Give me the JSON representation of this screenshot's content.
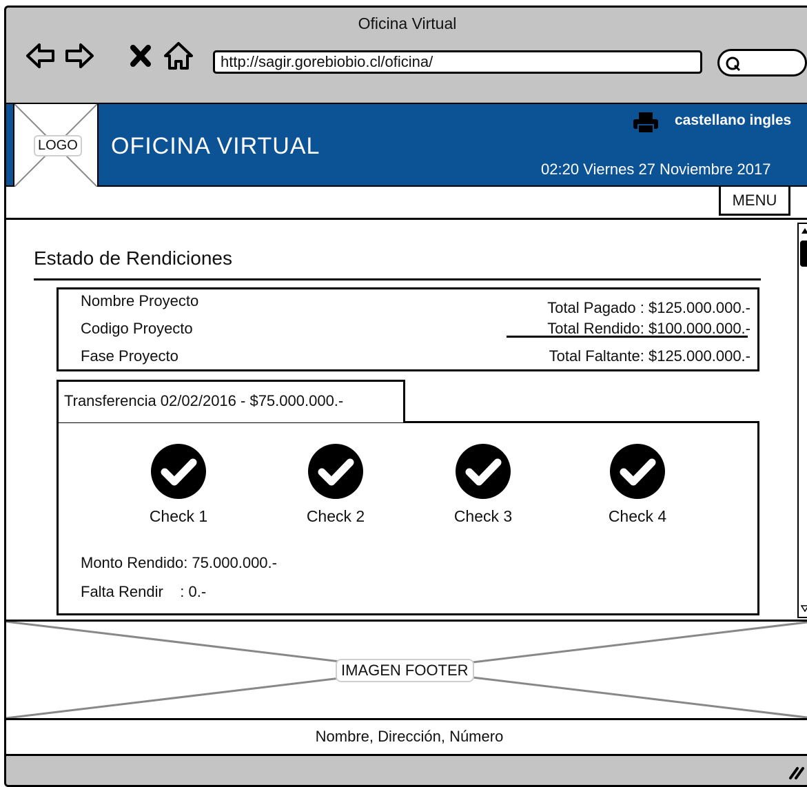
{
  "browser": {
    "title": "Oficina Virtual",
    "url": "http://sagir.gorebiobio.cl/oficina/",
    "nav_icons": [
      "back-arrow-icon",
      "forward-arrow-icon",
      "stop-icon",
      "home-icon"
    ],
    "search_icon": "search-icon"
  },
  "header": {
    "logo_label": "LOGO",
    "site_title": "OFICINA VIRTUAL",
    "print_icon": "printer-icon",
    "languages": "castellano ingles",
    "datetime": "02:20 Viernes 27 Noviembre 2017",
    "background_color": "#0c5396"
  },
  "menu": {
    "label": "MENU"
  },
  "main": {
    "page_title": "Estado de Rendiciones",
    "project": {
      "left": [
        "Nombre Proyecto",
        "Codigo Proyecto",
        "Fase Proyecto"
      ],
      "total_pagado": "Total Pagado : $125.000.000.-",
      "total_rendido": "Total Rendido: $100.000.000.-",
      "total_faltante": "Total Faltante: $125.000.000.-"
    },
    "transfer_tab": "Transferencia 02/02/2016 - $75.000.000.-",
    "checks": [
      "Check 1",
      "Check 2",
      "Check 3",
      "Check 4"
    ],
    "monto_rendido": "Monto Rendido: 75.000.000.-",
    "falta_rendir": "Falta Rendir    : 0.-"
  },
  "footer": {
    "image_label": "IMAGEN FOOTER",
    "contact": "Nombre, Dirección, Número"
  }
}
